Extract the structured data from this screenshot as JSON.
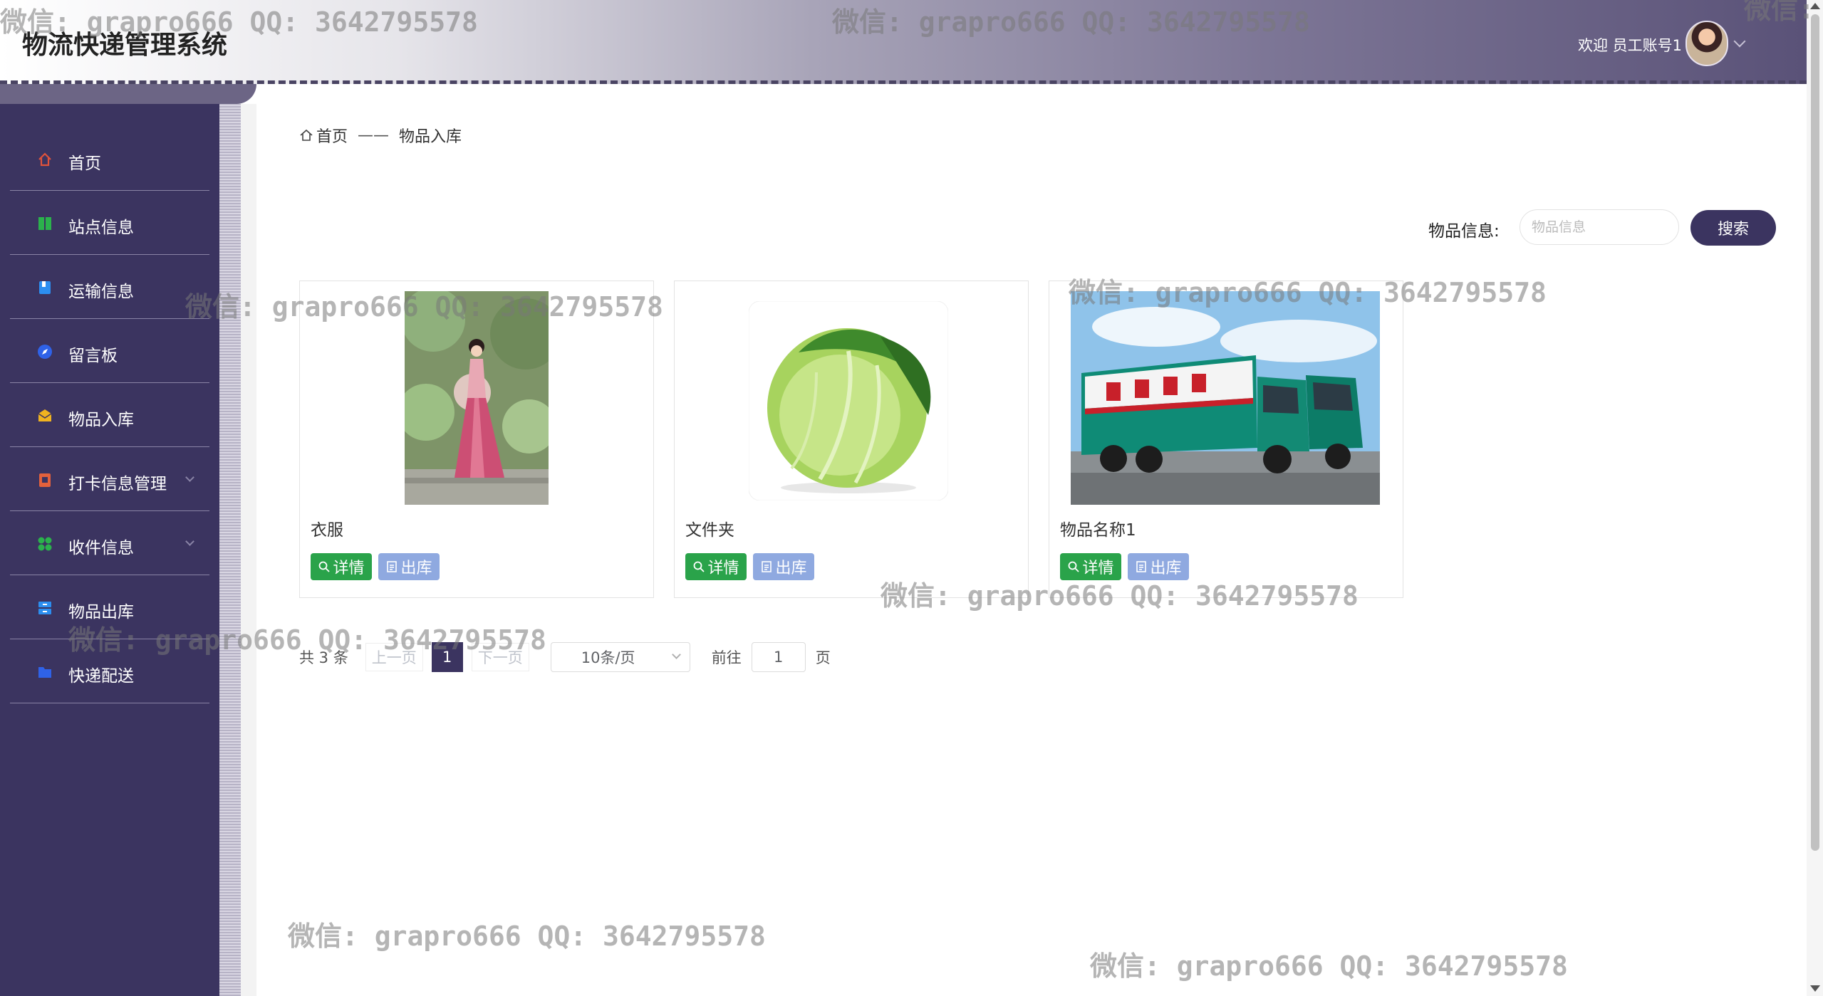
{
  "header": {
    "app_title": "物流快递管理系统",
    "welcome_text": "欢迎 员工账号1"
  },
  "sidebar": {
    "items": [
      {
        "label": "首页",
        "icon": "home-icon",
        "color": "#e0533b"
      },
      {
        "label": "站点信息",
        "icon": "columns-icon",
        "color": "#2bb24c"
      },
      {
        "label": "运输信息",
        "icon": "bookmark-icon",
        "color": "#2c8ef0"
      },
      {
        "label": "留言板",
        "icon": "compass-icon",
        "color": "#2f62e8"
      },
      {
        "label": "物品入库",
        "icon": "mail-icon",
        "color": "#f0b320"
      },
      {
        "label": "打卡信息管理",
        "icon": "clipboard-icon",
        "color": "#e3613c"
      },
      {
        "label": "收件信息",
        "icon": "grid-icon",
        "color": "#2bb24c"
      },
      {
        "label": "物品出库",
        "icon": "cabinet-icon",
        "color": "#2c8ef0"
      },
      {
        "label": "快递配送",
        "icon": "folder-icon",
        "color": "#2f62e8"
      }
    ]
  },
  "breadcrumb": {
    "home": "首页",
    "separator": "——",
    "current": "物品入库"
  },
  "search": {
    "label": "物品信息:",
    "placeholder": "物品信息",
    "value": "",
    "button_label": "搜索"
  },
  "cards": [
    {
      "name": "衣服",
      "photo": "woman-in-pink-dress-photo",
      "detail_label": "详情",
      "out_label": "出库"
    },
    {
      "name": "文件夹",
      "photo": "cabbage-photo",
      "detail_label": "详情",
      "out_label": "出库"
    },
    {
      "name": "物品名称1",
      "photo": "green-delivery-trucks-photo",
      "detail_label": "详情",
      "out_label": "出库"
    }
  ],
  "pagination": {
    "total_text": "共 3 条",
    "prev_label": "上一页",
    "current_page": "1",
    "next_label": "下一页",
    "page_size": "10条/页",
    "goto_label": "前往",
    "goto_value": "1",
    "page_unit": "页"
  },
  "watermarks": [
    "微信: grapro666 QQ: 3642795578",
    "微信: grapro666 QQ: 3642795578",
    "微信: grapro666 QQ: 3642795578",
    "微信: grapro666 QQ: 3642795578",
    "微信: grapro666 QQ: 3642795578",
    "微信: grapro666 QQ: 3642795578",
    "微信: grapro666 QQ: 3642795578",
    "微信: grapro666 QQ: 3642795578",
    "微信:"
  ],
  "colors": {
    "brand_dark": "#3b3460",
    "detail_button": "#2aa34a",
    "out_button": "#8fa9e0"
  }
}
